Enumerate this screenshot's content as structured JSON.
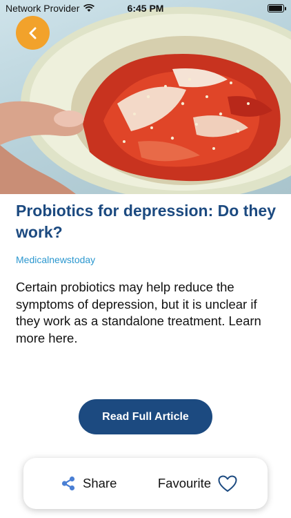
{
  "status_bar": {
    "carrier": "Network Provider",
    "time": "6:45 PM"
  },
  "hero": {
    "image_icon": "kimchi-bowl-photo"
  },
  "back_button": {
    "icon": "chevron-left-icon"
  },
  "article": {
    "title": "Probiotics for depression: Do they work?",
    "source": "Medicalnewstoday",
    "description": "Certain probiotics may help reduce the symptoms of depression, but it is unclear if they work as a standalone treatment. Learn more here."
  },
  "read_button": {
    "label": "Read Full Article"
  },
  "bottom_bar": {
    "share_label": "Share",
    "favourite_label": "Favourite"
  },
  "colors": {
    "accent_orange": "#f2a22b",
    "brand_blue": "#1c4a80",
    "source_blue": "#2b97cf",
    "share_icon": "#4a7fd4",
    "heart_icon": "#1c4a80"
  }
}
